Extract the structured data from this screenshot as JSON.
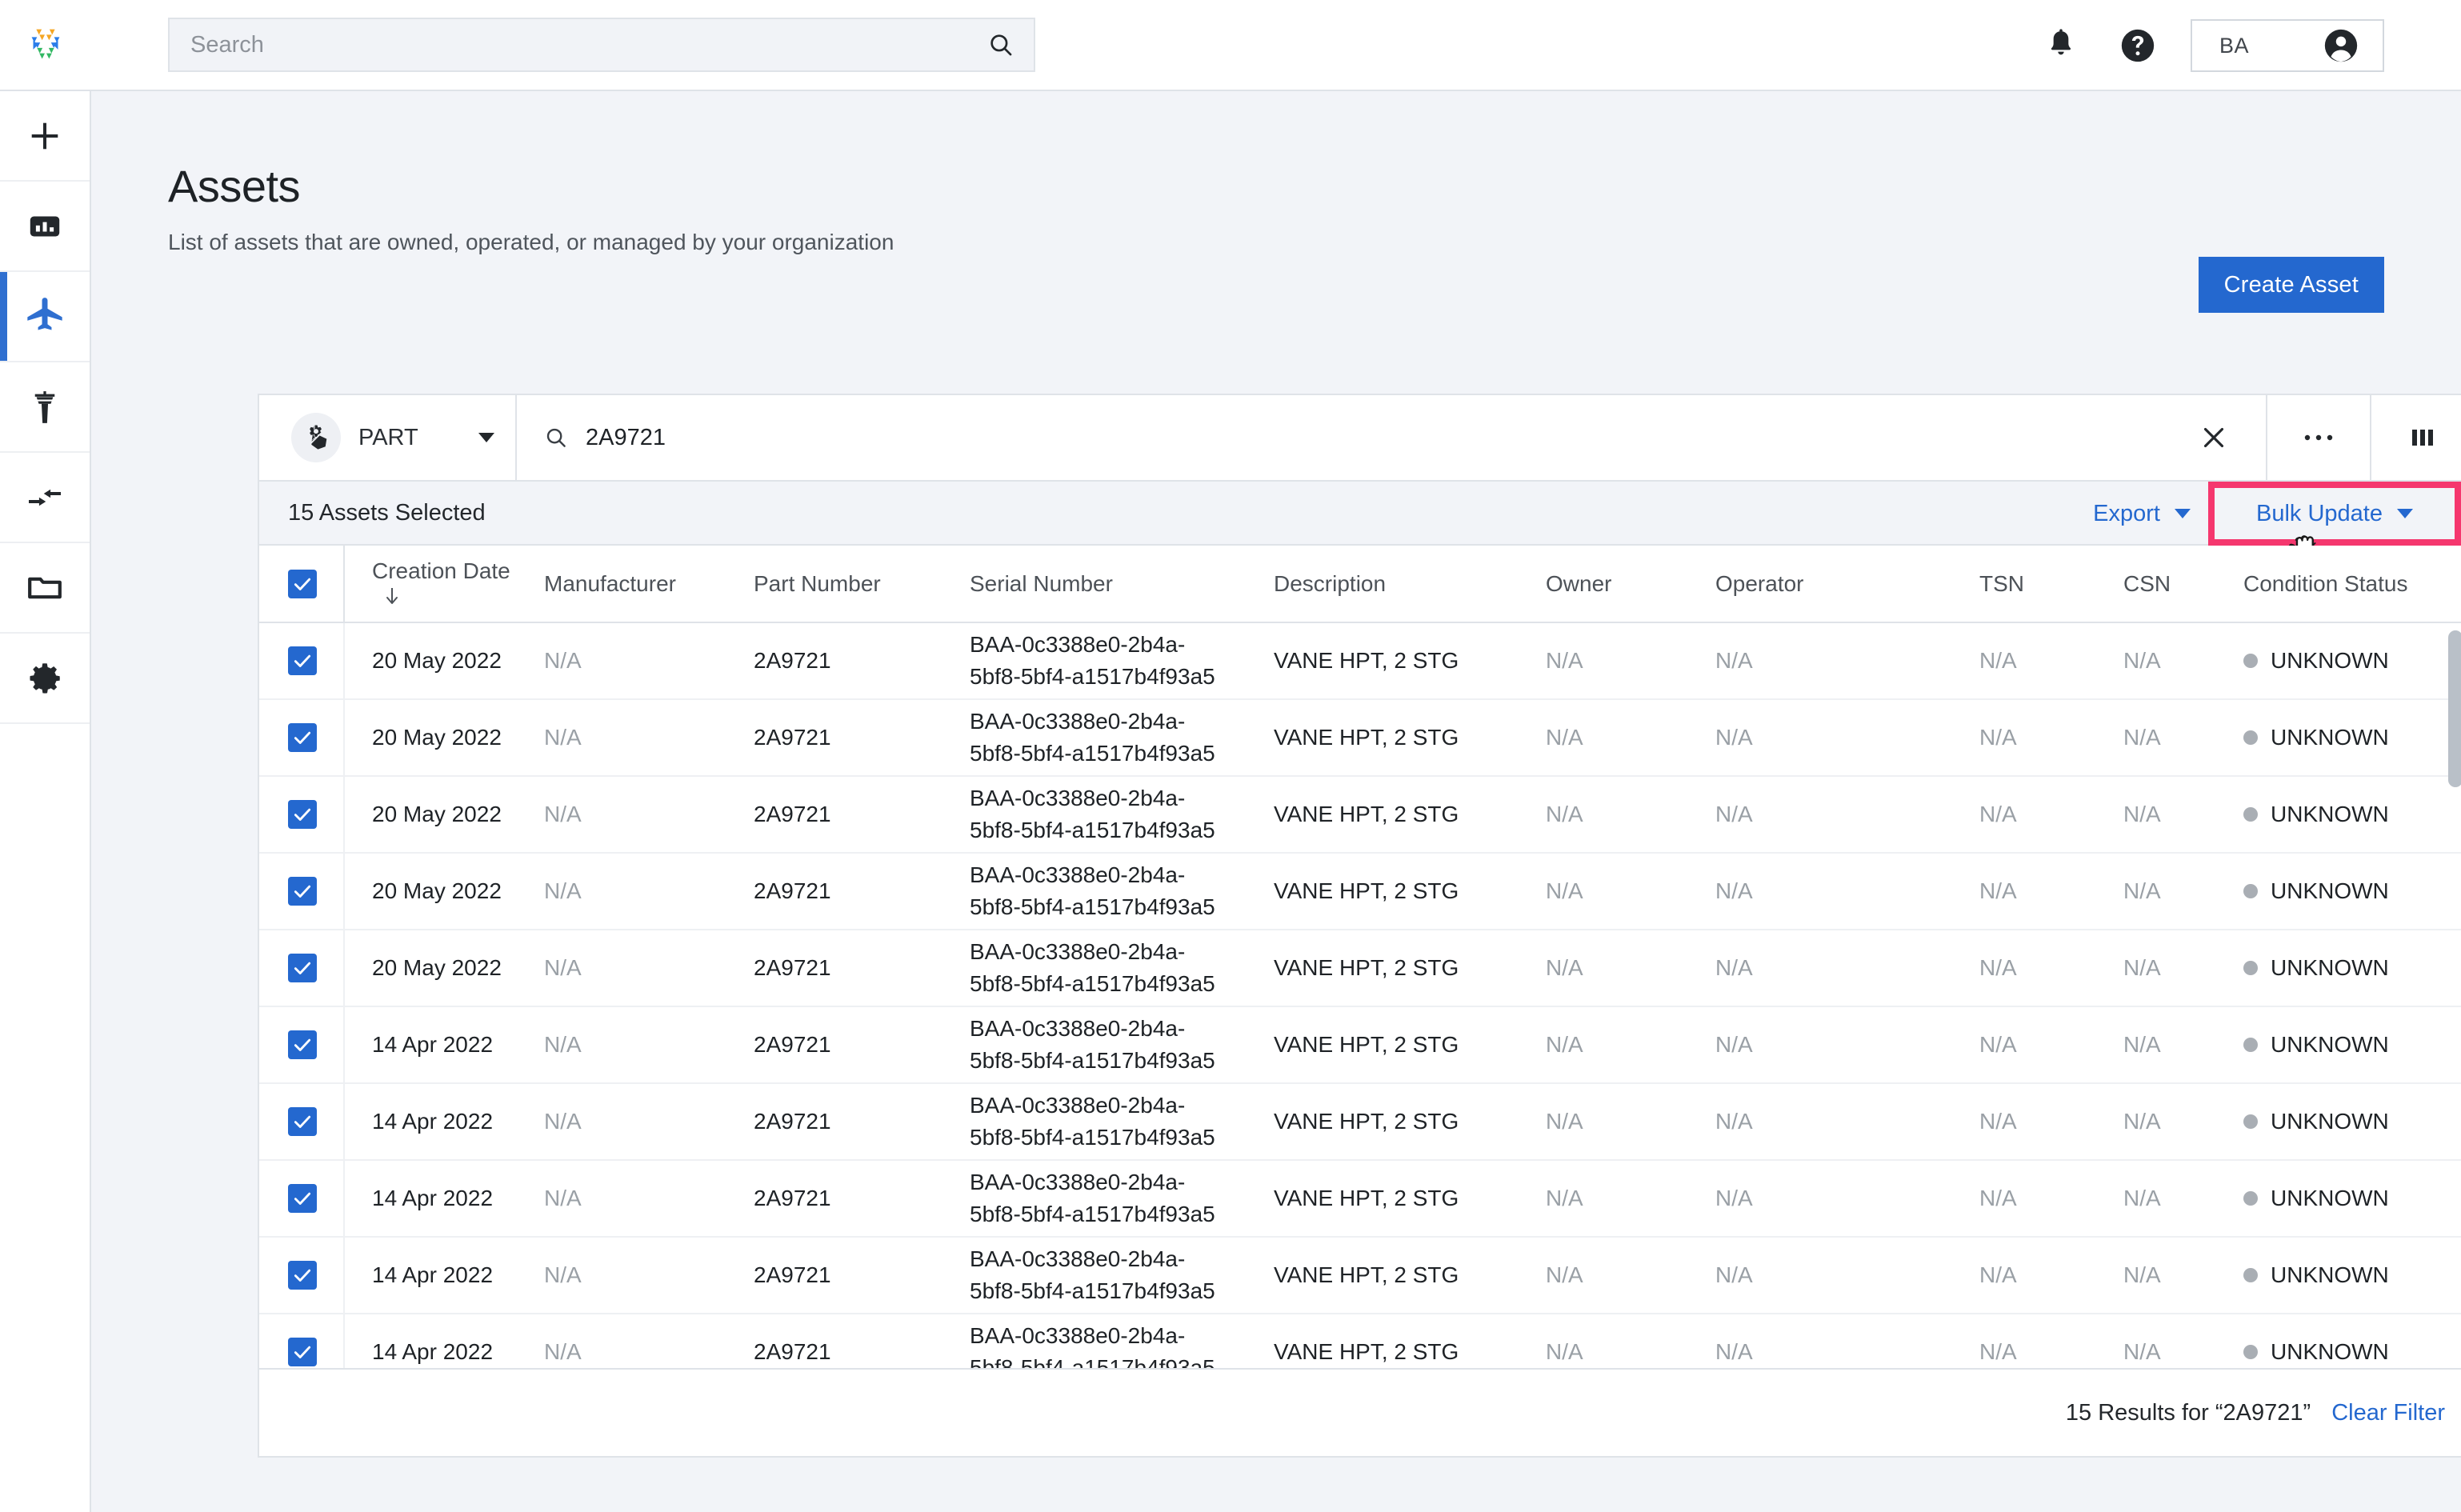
{
  "brand": {
    "logo_name": "hexagon-logo",
    "accent": "#2468cf",
    "highlight": "#f5376e"
  },
  "header": {
    "search": {
      "placeholder": "Search",
      "value": ""
    },
    "notifications_icon": "bell-icon",
    "help_icon": "help-circle-icon",
    "account_initials": "BA",
    "account_icon": "account-circle-icon"
  },
  "sidebar": {
    "items": [
      {
        "name": "add",
        "icon": "plus-icon",
        "active": false
      },
      {
        "name": "dashboard",
        "icon": "chart-icon",
        "active": false
      },
      {
        "name": "assets",
        "icon": "airplane-icon",
        "active": true
      },
      {
        "name": "operations",
        "icon": "control-tower-icon",
        "active": false
      },
      {
        "name": "transfers",
        "icon": "transfer-arrows-icon",
        "active": false
      },
      {
        "name": "documents",
        "icon": "folder-icon",
        "active": false
      },
      {
        "name": "settings",
        "icon": "gear-icon",
        "active": false
      }
    ]
  },
  "page": {
    "title": "Assets",
    "subtitle": "List of assets that are owned, operated, or managed by your organization",
    "create_button": "Create Asset"
  },
  "filter_bar": {
    "type_label": "PART",
    "type_icon": "part-gear-icon",
    "search_value": "2A9721",
    "search_placeholder": "Search",
    "clear_icon": "close-icon",
    "more_icon": "more-horizontal-icon",
    "columns_icon": "columns-icon"
  },
  "selection_bar": {
    "selected_text": "15 Assets Selected",
    "export_label": "Export",
    "bulk_update_label": "Bulk Update"
  },
  "table": {
    "columns": [
      "Creation Date",
      "Manufacturer",
      "Part Number",
      "Serial Number",
      "Description",
      "Owner",
      "Operator",
      "TSN",
      "CSN",
      "Condition Status"
    ],
    "sort_column": "Creation Date",
    "sort_direction": "desc",
    "header_checkbox_checked": true,
    "rows": [
      {
        "checked": true,
        "creation_date": "20 May 2022",
        "manufacturer": "N/A",
        "part_number": "2A9721",
        "serial_line1": "BAA-0c3388e0-2b4a-",
        "serial_line2": "5bf8-5bf4-a1517b4f93a5",
        "description": "VANE HPT, 2 STG",
        "owner": "N/A",
        "operator": "N/A",
        "tsn": "N/A",
        "csn": "N/A",
        "condition_status": "UNKNOWN"
      },
      {
        "checked": true,
        "creation_date": "20 May 2022",
        "manufacturer": "N/A",
        "part_number": "2A9721",
        "serial_line1": "BAA-0c3388e0-2b4a-",
        "serial_line2": "5bf8-5bf4-a1517b4f93a5",
        "description": "VANE HPT, 2 STG",
        "owner": "N/A",
        "operator": "N/A",
        "tsn": "N/A",
        "csn": "N/A",
        "condition_status": "UNKNOWN"
      },
      {
        "checked": true,
        "creation_date": "20 May 2022",
        "manufacturer": "N/A",
        "part_number": "2A9721",
        "serial_line1": "BAA-0c3388e0-2b4a-",
        "serial_line2": "5bf8-5bf4-a1517b4f93a5",
        "description": "VANE HPT, 2 STG",
        "owner": "N/A",
        "operator": "N/A",
        "tsn": "N/A",
        "csn": "N/A",
        "condition_status": "UNKNOWN"
      },
      {
        "checked": true,
        "creation_date": "20 May 2022",
        "manufacturer": "N/A",
        "part_number": "2A9721",
        "serial_line1": "BAA-0c3388e0-2b4a-",
        "serial_line2": "5bf8-5bf4-a1517b4f93a5",
        "description": "VANE HPT, 2 STG",
        "owner": "N/A",
        "operator": "N/A",
        "tsn": "N/A",
        "csn": "N/A",
        "condition_status": "UNKNOWN"
      },
      {
        "checked": true,
        "creation_date": "20 May 2022",
        "manufacturer": "N/A",
        "part_number": "2A9721",
        "serial_line1": "BAA-0c3388e0-2b4a-",
        "serial_line2": "5bf8-5bf4-a1517b4f93a5",
        "description": "VANE HPT, 2 STG",
        "owner": "N/A",
        "operator": "N/A",
        "tsn": "N/A",
        "csn": "N/A",
        "condition_status": "UNKNOWN"
      },
      {
        "checked": true,
        "creation_date": "14 Apr 2022",
        "manufacturer": "N/A",
        "part_number": "2A9721",
        "serial_line1": "BAA-0c3388e0-2b4a-",
        "serial_line2": "5bf8-5bf4-a1517b4f93a5",
        "description": "VANE HPT, 2 STG",
        "owner": "N/A",
        "operator": "N/A",
        "tsn": "N/A",
        "csn": "N/A",
        "condition_status": "UNKNOWN"
      },
      {
        "checked": true,
        "creation_date": "14 Apr 2022",
        "manufacturer": "N/A",
        "part_number": "2A9721",
        "serial_line1": "BAA-0c3388e0-2b4a-",
        "serial_line2": "5bf8-5bf4-a1517b4f93a5",
        "description": "VANE HPT, 2 STG",
        "owner": "N/A",
        "operator": "N/A",
        "tsn": "N/A",
        "csn": "N/A",
        "condition_status": "UNKNOWN"
      },
      {
        "checked": true,
        "creation_date": "14 Apr 2022",
        "manufacturer": "N/A",
        "part_number": "2A9721",
        "serial_line1": "BAA-0c3388e0-2b4a-",
        "serial_line2": "5bf8-5bf4-a1517b4f93a5",
        "description": "VANE HPT, 2 STG",
        "owner": "N/A",
        "operator": "N/A",
        "tsn": "N/A",
        "csn": "N/A",
        "condition_status": "UNKNOWN"
      },
      {
        "checked": true,
        "creation_date": "14 Apr 2022",
        "manufacturer": "N/A",
        "part_number": "2A9721",
        "serial_line1": "BAA-0c3388e0-2b4a-",
        "serial_line2": "5bf8-5bf4-a1517b4f93a5",
        "description": "VANE HPT, 2 STG",
        "owner": "N/A",
        "operator": "N/A",
        "tsn": "N/A",
        "csn": "N/A",
        "condition_status": "UNKNOWN"
      },
      {
        "checked": true,
        "creation_date": "14 Apr 2022",
        "manufacturer": "N/A",
        "part_number": "2A9721",
        "serial_line1": "BAA-0c3388e0-2b4a-",
        "serial_line2": "5bf8-5bf4-a1517b4f93a5",
        "description": "VANE HPT, 2 STG",
        "owner": "N/A",
        "operator": "N/A",
        "tsn": "N/A",
        "csn": "N/A",
        "condition_status": "UNKNOWN"
      },
      {
        "checked": true,
        "creation_date": "",
        "manufacturer": "",
        "part_number": "",
        "serial_line1": "BAA-0c3388e0-2b4a-",
        "serial_line2": "",
        "description": "",
        "owner": "",
        "operator": "",
        "tsn": "",
        "csn": "",
        "condition_status": ""
      }
    ]
  },
  "footer": {
    "results_text": "15 Results for “2A9721”",
    "clear_filter": "Clear Filter"
  }
}
